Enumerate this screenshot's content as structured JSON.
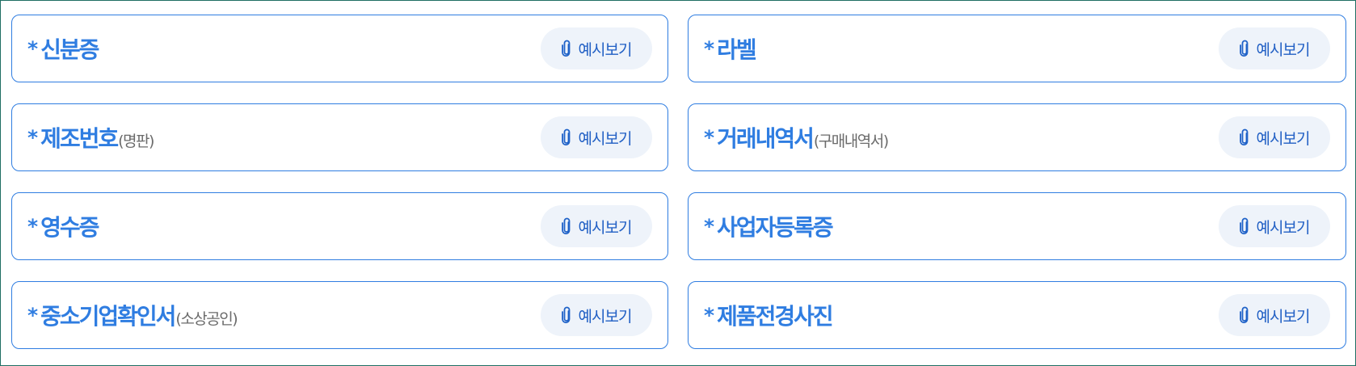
{
  "items": [
    {
      "asterisk": "*",
      "title": "신분증",
      "sub": "",
      "button": "예시보기"
    },
    {
      "asterisk": "*",
      "title": "라벨",
      "sub": "",
      "button": "예시보기"
    },
    {
      "asterisk": "*",
      "title": "제조번호",
      "sub": "(명판)",
      "button": "예시보기"
    },
    {
      "asterisk": "*",
      "title": "거래내역서",
      "sub": "(구매내역서)",
      "button": "예시보기"
    },
    {
      "asterisk": "*",
      "title": "영수증",
      "sub": "",
      "button": "예시보기"
    },
    {
      "asterisk": "*",
      "title": "사업자등록증",
      "sub": "",
      "button": "예시보기"
    },
    {
      "asterisk": "*",
      "title": "중소기업확인서",
      "sub": "(소상공인)",
      "button": "예시보기"
    },
    {
      "asterisk": "*",
      "title": "제품전경사진",
      "sub": "",
      "button": "예시보기"
    }
  ],
  "icons": {
    "button_icon": "paperclip-icon"
  },
  "colors": {
    "accent": "#2f7de1",
    "button_bg": "#eef3fa",
    "sub_text": "#6b6b6b",
    "frame_border": "#1f6e63"
  }
}
